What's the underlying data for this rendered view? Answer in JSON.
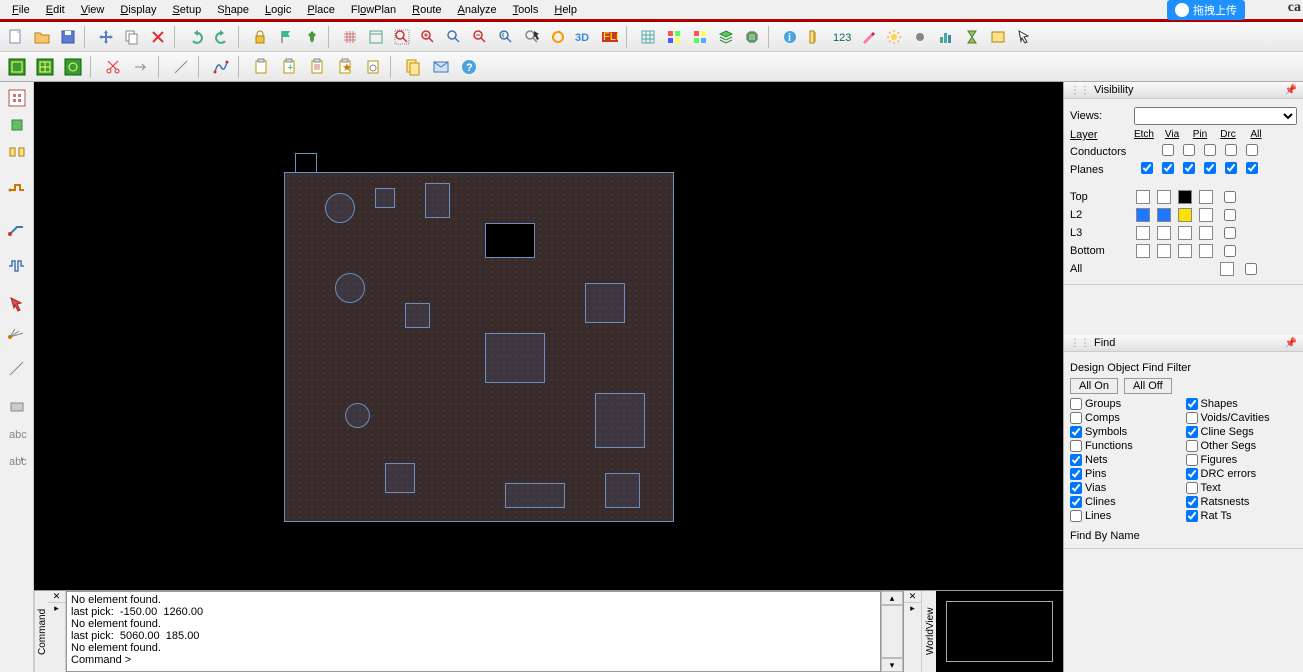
{
  "menu": [
    "File",
    "Edit",
    "View",
    "Display",
    "Setup",
    "Shape",
    "Logic",
    "Place",
    "FlowPlan",
    "Route",
    "Analyze",
    "Tools",
    "Help"
  ],
  "brand": "ca",
  "cloud_label": "拖拽上传",
  "visibility": {
    "title": "Visibility",
    "views_label": "Views:",
    "layer_label": "Layer",
    "cols": [
      "Etch",
      "Via",
      "Pin",
      "Drc",
      "All"
    ],
    "rows": [
      {
        "name": "Conductors",
        "checks": [
          false,
          false,
          false,
          false,
          false
        ]
      },
      {
        "name": "Planes",
        "checks": [
          true,
          true,
          true,
          true,
          true,
          true
        ]
      }
    ],
    "color_rows": [
      {
        "name": "Top",
        "colors": [
          "#ffffff",
          "#ffffff",
          "#000000",
          "#ffffff"
        ],
        "check": false
      },
      {
        "name": "L2",
        "colors": [
          "#1e78ff",
          "#1e78ff",
          "#ffe100",
          "#ffffff"
        ],
        "check": false
      },
      {
        "name": "L3",
        "colors": [
          "#ffffff",
          "#ffffff",
          "#ffffff",
          "#ffffff"
        ],
        "check": false
      },
      {
        "name": "Bottom",
        "colors": [
          "#ffffff",
          "#ffffff",
          "#ffffff",
          "#ffffff"
        ],
        "check": false
      },
      {
        "name": "All",
        "colors": [],
        "check": false,
        "allrow": true
      }
    ]
  },
  "find": {
    "title": "Find",
    "subtitle": "Design Object Find Filter",
    "all_on": "All On",
    "all_off": "All Off",
    "items": [
      {
        "label": "Groups",
        "checked": false
      },
      {
        "label": "Shapes",
        "checked": true
      },
      {
        "label": "Comps",
        "checked": false
      },
      {
        "label": "Voids/Cavities",
        "checked": false
      },
      {
        "label": "Symbols",
        "checked": true
      },
      {
        "label": "Cline Segs",
        "checked": true
      },
      {
        "label": "Functions",
        "checked": false
      },
      {
        "label": "Other Segs",
        "checked": false
      },
      {
        "label": "Nets",
        "checked": true
      },
      {
        "label": "Figures",
        "checked": false
      },
      {
        "label": "Pins",
        "checked": true
      },
      {
        "label": "DRC errors",
        "checked": true
      },
      {
        "label": "Vias",
        "checked": true
      },
      {
        "label": "Text",
        "checked": false
      },
      {
        "label": "Clines",
        "checked": true
      },
      {
        "label": "Ratsnests",
        "checked": true
      },
      {
        "label": "Lines",
        "checked": false
      },
      {
        "label": "Rat Ts",
        "checked": true
      }
    ],
    "find_by_name": "Find By Name"
  },
  "command": {
    "label": "Command",
    "lines": "No element found.\nlast pick:  -150.00  1260.00\nNo element found.\nlast pick:  5060.00  185.00\nNo element found.\nCommand >"
  },
  "worldview_label": "WorldView"
}
